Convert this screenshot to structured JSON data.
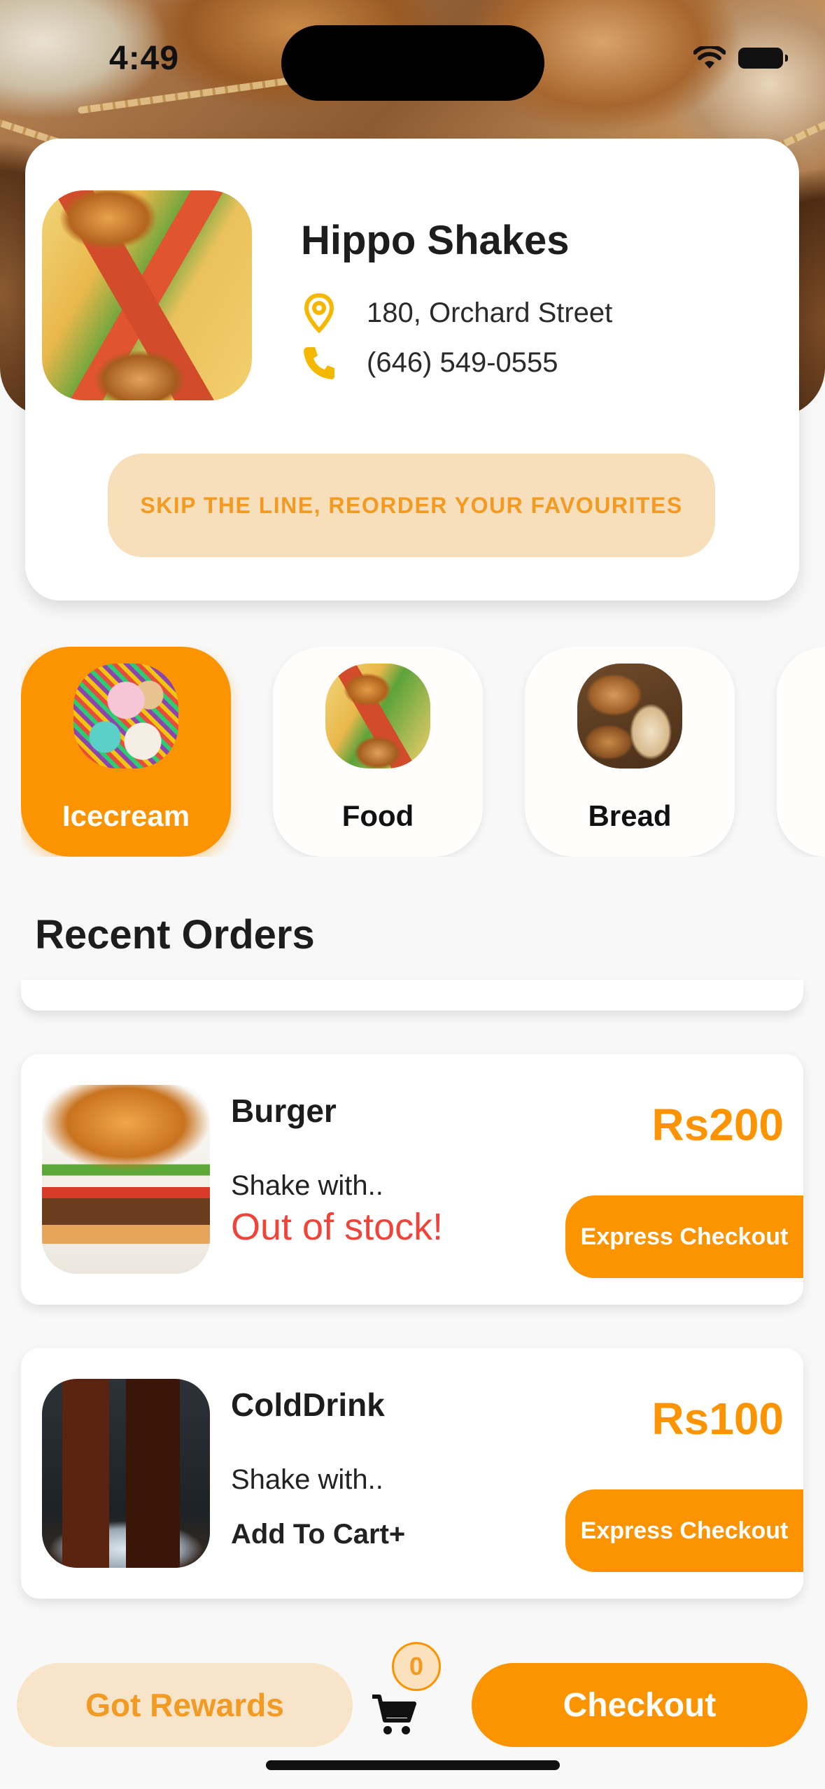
{
  "status_bar": {
    "time": "4:49"
  },
  "store": {
    "name": "Hippo Shakes",
    "address": "180, Orchard Street",
    "phone": "(646) 549-0555",
    "skip_line_label": "SKIP THE LINE, REORDER YOUR FAVOURITES",
    "icons": {
      "location": "location-pin-icon",
      "phone": "phone-icon"
    }
  },
  "categories": [
    {
      "label": "Icecream",
      "selected": true
    },
    {
      "label": "Food",
      "selected": false
    },
    {
      "label": "Bread",
      "selected": false
    }
  ],
  "recent_orders": {
    "title": "Recent Orders",
    "items": [
      {
        "name": "Burger",
        "description": "Shake with..",
        "status": "Out of stock!",
        "price": "Rs200",
        "action_label": "Express Checkout"
      },
      {
        "name": "ColdDrink",
        "description": "Shake with..",
        "cart_label": "Add To Cart+",
        "price": "Rs100",
        "action_label": "Express Checkout"
      }
    ]
  },
  "bottom_bar": {
    "rewards_label": "Got Rewards",
    "cart_count": "0",
    "checkout_label": "Checkout"
  },
  "colors": {
    "accent": "#fb9400",
    "accent_light": "#f8dfbb",
    "error": "#f0443a",
    "location_icon": "#f5b800"
  }
}
